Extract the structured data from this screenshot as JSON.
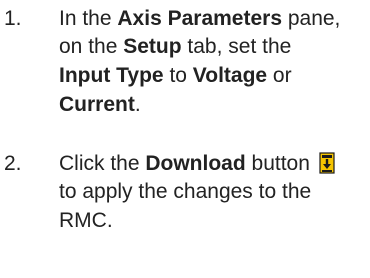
{
  "steps": [
    {
      "number": "1.",
      "line1": {
        "t1": "In the ",
        "b1": "Axis Parameters",
        "t2": " pane,"
      },
      "line2": {
        "t1": "on the ",
        "b1": "Setup",
        "t2": " tab, set the"
      },
      "line3": {
        "b1": "Input Type",
        "t1": " to ",
        "b2": "Voltage",
        "t2": " or"
      },
      "line4": {
        "b1": "Current",
        "t1": "."
      }
    },
    {
      "number": "2.",
      "line1": {
        "t1": "Click the ",
        "b1": "Download",
        "t2": " button ",
        "icon": "download-icon"
      },
      "line2": {
        "t1": "to apply the changes to the"
      },
      "line3": {
        "t1": "RMC."
      }
    }
  ],
  "colors": {
    "text": "#222222",
    "icon_yellow": "#f5c400",
    "icon_dark": "#1a1a1a"
  }
}
